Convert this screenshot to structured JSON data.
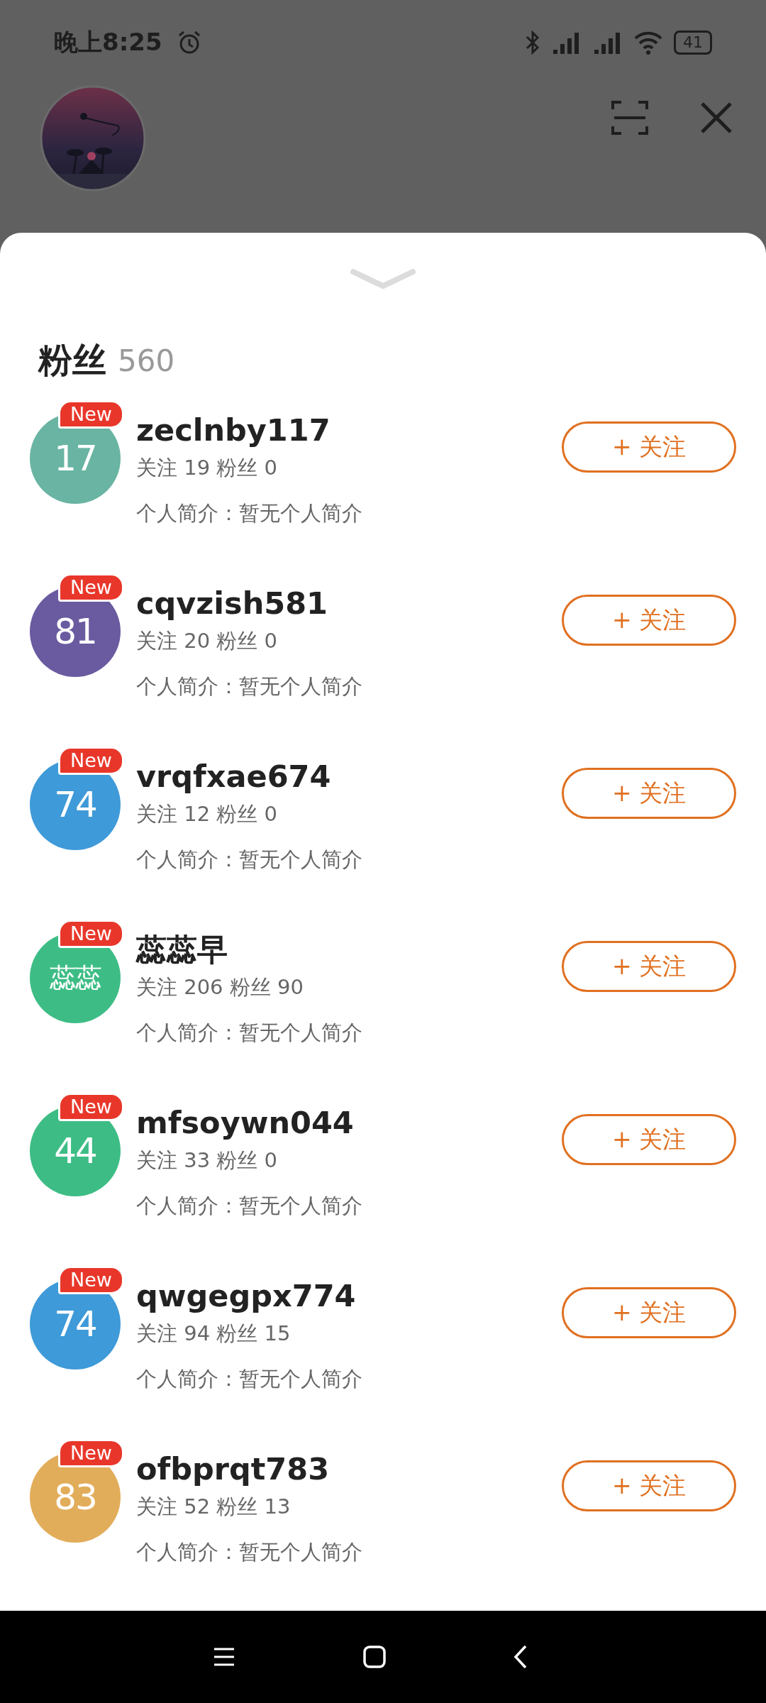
{
  "status_bar": {
    "time": "晚上8:25",
    "battery": "41"
  },
  "sheet": {
    "title": "粉丝",
    "count": "560",
    "followers": [
      {
        "avatar_text": "17",
        "color": "#69b4a2",
        "badge": "New",
        "name": "zeclnby117",
        "stats": "关注 19 粉丝 0",
        "bio": "个人简介：暂无个人简介",
        "button": "+ 关注"
      },
      {
        "avatar_text": "81",
        "color": "#6a5aa0",
        "badge": "New",
        "name": "cqvzish581",
        "stats": "关注 20 粉丝 0",
        "bio": "个人简介：暂无个人简介",
        "button": "+ 关注"
      },
      {
        "avatar_text": "74",
        "color": "#3e9ad8",
        "badge": "New",
        "name": "vrqfxae674",
        "stats": "关注 12 粉丝 0",
        "bio": "个人简介：暂无个人简介",
        "button": "+ 关注"
      },
      {
        "avatar_text": "蕊蕊",
        "color": "#3dbd85",
        "badge": "New",
        "name": "蕊蕊早",
        "stats": "关注 206 粉丝 90",
        "bio": "个人简介：暂无个人简介",
        "button": "+ 关注"
      },
      {
        "avatar_text": "44",
        "color": "#3dbd85",
        "badge": "New",
        "name": "mfsoywn044",
        "stats": "关注 33 粉丝 0",
        "bio": "个人简介：暂无个人简介",
        "button": "+ 关注"
      },
      {
        "avatar_text": "74",
        "color": "#3e9ad8",
        "badge": "New",
        "name": "qwgegpx774",
        "stats": "关注 94 粉丝 15",
        "bio": "个人简介：暂无个人简介",
        "button": "+ 关注"
      },
      {
        "avatar_text": "83",
        "color": "#e2ad5a",
        "badge": "New",
        "name": "ofbprqt783",
        "stats": "关注 52 粉丝 13",
        "bio": "个人简介：暂无个人简介",
        "button": "+ 关注"
      }
    ]
  }
}
